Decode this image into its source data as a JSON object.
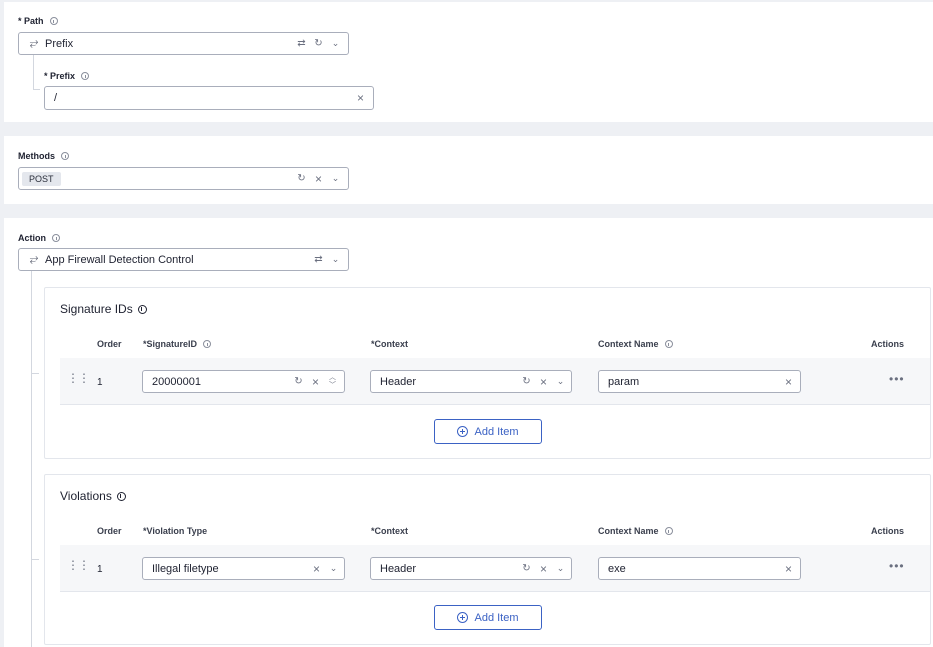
{
  "path": {
    "label": "* Path",
    "value": "Prefix",
    "icons": [
      "swap-icon",
      "refresh-icon",
      "chevron-down-icon"
    ],
    "prefix": {
      "label": "* Prefix",
      "value": "/"
    }
  },
  "methods": {
    "label": "Methods",
    "tags": [
      "POST"
    ]
  },
  "action": {
    "label": "Action",
    "value": "App Firewall Detection Control"
  },
  "signature_ids": {
    "title": "Signature IDs",
    "columns": {
      "order": "Order",
      "id": "*SignatureID",
      "context": "*Context",
      "context_name": "Context Name",
      "actions": "Actions"
    },
    "rows": [
      {
        "order": "1",
        "id": "20000001",
        "context": "Header",
        "context_name": "param"
      }
    ],
    "add_label": "Add Item"
  },
  "violations": {
    "title": "Violations",
    "columns": {
      "order": "Order",
      "type": "*Violation Type",
      "context": "*Context",
      "context_name": "Context Name",
      "actions": "Actions"
    },
    "rows": [
      {
        "order": "1",
        "type": "Illegal filetype",
        "context": "Header",
        "context_name": "exe"
      }
    ],
    "add_label": "Add Item"
  },
  "colors": {
    "accent": "#3b62c4",
    "border": "#a9aebb",
    "background": "#eef0f4"
  }
}
